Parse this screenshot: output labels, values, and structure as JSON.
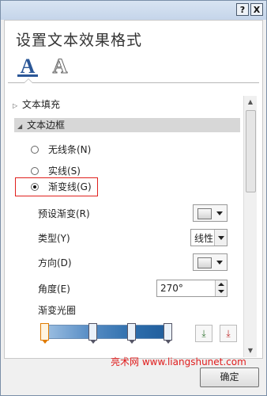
{
  "window": {
    "help_button": "?",
    "close_button": "X"
  },
  "pane": {
    "title": "设置文本效果格式",
    "tabs": [
      {
        "icon": "text-fill-outline-icon",
        "glyph": "A",
        "selected": true
      },
      {
        "icon": "text-effects-icon",
        "glyph": "A",
        "selected": false
      }
    ]
  },
  "sections": [
    {
      "label": "文本填充",
      "expanded": false
    },
    {
      "label": "文本边框",
      "expanded": true
    }
  ],
  "border_options": [
    {
      "label": "无线条(N)",
      "selected": false
    },
    {
      "label": "实线(S)",
      "selected": false
    },
    {
      "label": "渐变线(G)",
      "selected": true
    }
  ],
  "gradient": {
    "preset_label": "预设渐变(R)",
    "type_label": "类型(Y)",
    "type_value": "线性",
    "direction_label": "方向(D)",
    "angle_label": "角度(E)",
    "angle_value": "270°",
    "stops_label": "渐变光圈",
    "stops_count": 4,
    "add_stop_icon": "add-gradient-stop-icon",
    "remove_stop_icon": "remove-gradient-stop-icon"
  },
  "scrollbar": {
    "up": "▲",
    "down": "▼"
  },
  "footer": {
    "watermark": "亮术网 www.liangshunet.com",
    "ok_label": "确定"
  },
  "colors": {
    "accent": "#2b5797",
    "highlight_border": "#e0201d",
    "watermark": "#e01c1c"
  }
}
